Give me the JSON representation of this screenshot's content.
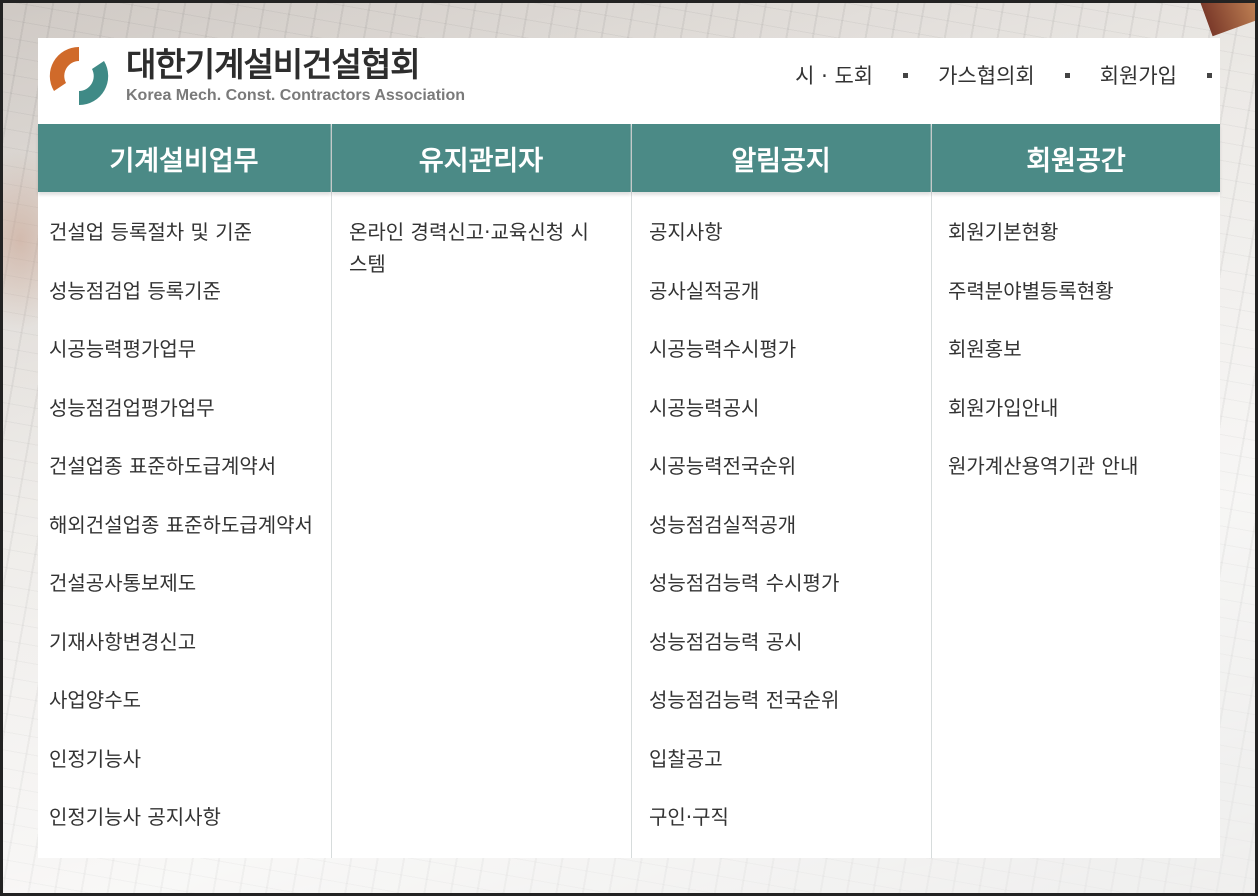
{
  "header": {
    "logo": {
      "title_ko": "대한기계설비건설협회",
      "title_en": "Korea Mech. Const. Contractors Association"
    },
    "topnav": [
      "시 · 도회",
      "가스협의회",
      "회원가입"
    ]
  },
  "colors": {
    "teal": "#4b8a86",
    "logo_orange": "#d06a2a",
    "logo_teal": "#3f8a86"
  },
  "menu": {
    "columns": [
      {
        "title": "기계설비업무",
        "items": [
          "건설업 등록절차 및 기준",
          "성능점검업 등록기준",
          "시공능력평가업무",
          "성능점검업평가업무",
          "건설업종 표준하도급계약서",
          "해외건설업종 표준하도급계약서",
          "건설공사통보제도",
          "기재사항변경신고",
          "사업양수도",
          "인정기능사",
          "인정기능사 공지사항"
        ]
      },
      {
        "title": "유지관리자",
        "items": [
          "온라인 경력신고·교육신청 시스템"
        ]
      },
      {
        "title": "알림공지",
        "items": [
          "공지사항",
          "공사실적공개",
          "시공능력수시평가",
          "시공능력공시",
          "시공능력전국순위",
          "성능점검실적공개",
          "성능점검능력 수시평가",
          "성능점검능력 공시",
          "성능점검능력 전국순위",
          "입찰공고",
          "구인·구직"
        ]
      },
      {
        "title": "회원공간",
        "items": [
          "회원기본현황",
          "주력분야별등록현황",
          "회원홍보",
          "회원가입안내",
          "원가계산용역기관 안내"
        ]
      }
    ]
  }
}
